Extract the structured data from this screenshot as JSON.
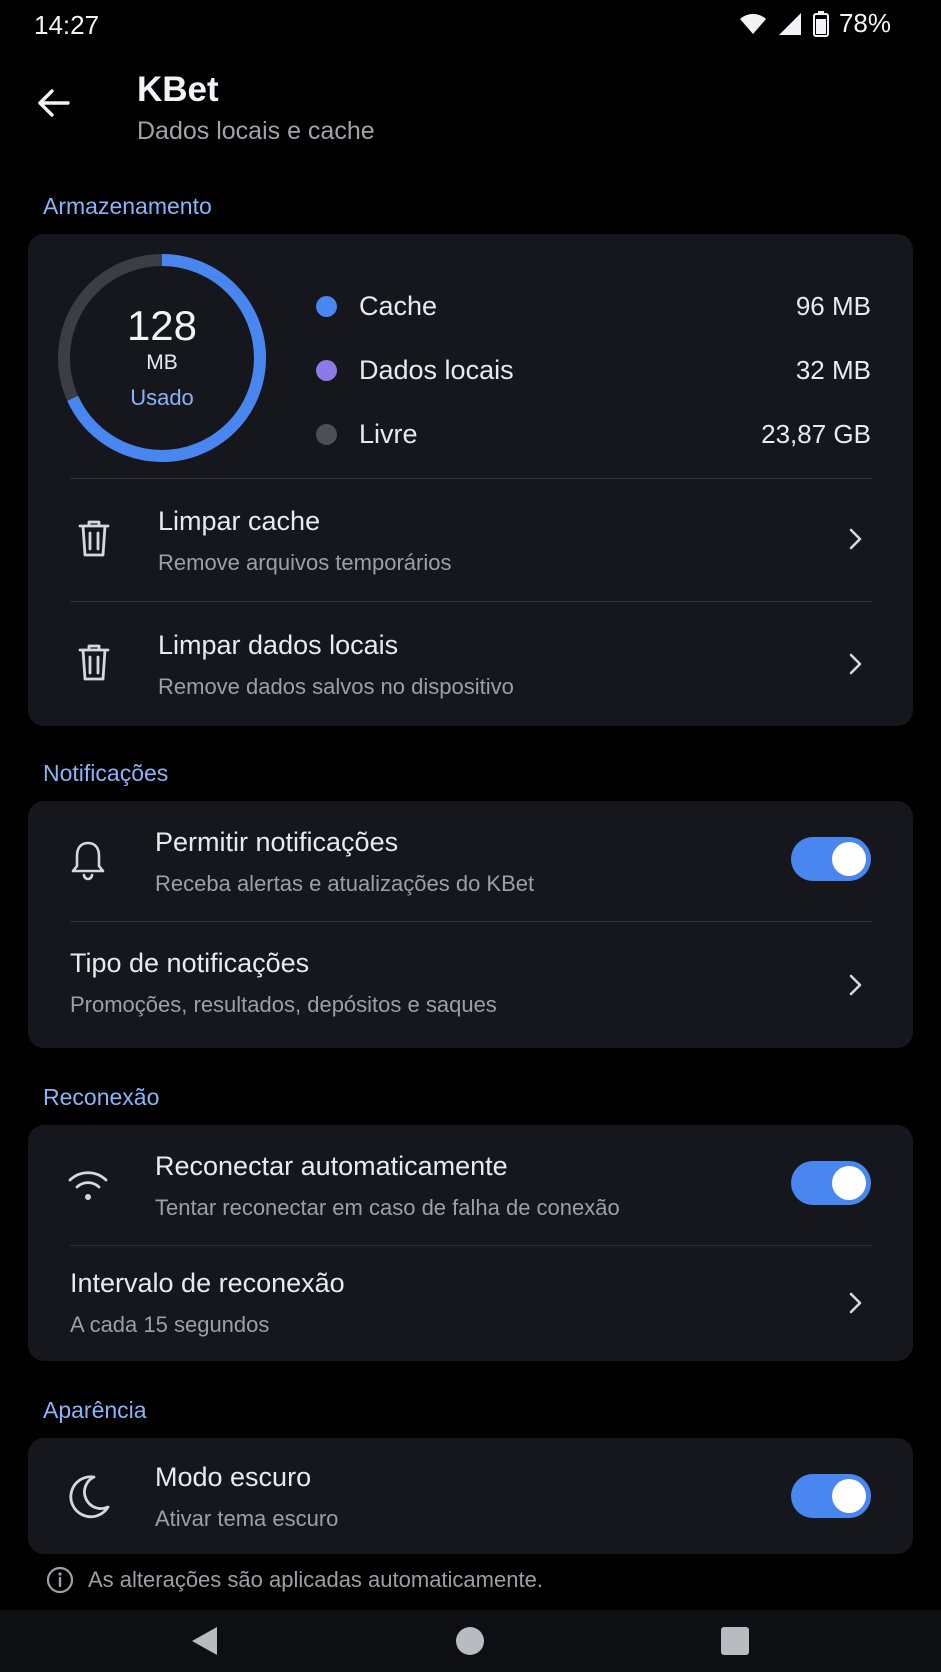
{
  "status": {
    "time": "14:27",
    "battery": "78%",
    "icons": [
      "wifi-icon",
      "signal-icon",
      "battery-icon"
    ]
  },
  "header": {
    "title": "KBet",
    "subtitle": "Dados locais e cache",
    "back_icon": "arrow-left-icon"
  },
  "storage": {
    "section_title": "Armazenamento",
    "used_value": "128",
    "used_unit": "MB",
    "used_label": "Usado",
    "legend": [
      {
        "label": "Cache",
        "value": "96 MB",
        "color": "#4a86f0"
      },
      {
        "label": "Dados locais",
        "value": "32 MB",
        "color": "#8c7ae6"
      },
      {
        "label": "Livre",
        "value": "23,87 GB",
        "color": "#4b4f57"
      }
    ],
    "actions": [
      {
        "title": "Limpar cache",
        "subtitle": "Remove arquivos temporários",
        "icon": "trash-icon"
      },
      {
        "title": "Limpar dados locais",
        "subtitle": "Remove dados salvos no dispositivo",
        "icon": "trash-icon"
      }
    ]
  },
  "notifications": {
    "section_title": "Notificações",
    "allow": {
      "title": "Permitir notificações",
      "subtitle": "Receba alertas e atualizações do KBet",
      "enabled": true,
      "icon": "bell-icon"
    },
    "types": {
      "title": "Tipo de notificações",
      "subtitle": "Promoções, resultados, depósitos e saques"
    }
  },
  "reconnect": {
    "section_title": "Reconexão",
    "auto": {
      "title": "Reconectar automaticamente",
      "subtitle": "Tentar reconectar em caso de falha de conexão",
      "enabled": true,
      "icon": "wifi-icon"
    },
    "interval": {
      "title": "Intervalo de reconexão",
      "subtitle": "A cada 15 segundos"
    }
  },
  "appearance": {
    "section_title": "Aparência",
    "dark_mode": {
      "title": "Modo escuro",
      "subtitle": "Ativar tema escuro",
      "enabled": true,
      "icon": "moon-icon"
    }
  },
  "footer": {
    "note": "As alterações são aplicadas automaticamente.",
    "icon": "info-icon"
  },
  "colors": {
    "accent": "#8ab4f8",
    "toggle_on": "#4a86f0",
    "card_bg": "#15171c",
    "background": "#000000"
  }
}
